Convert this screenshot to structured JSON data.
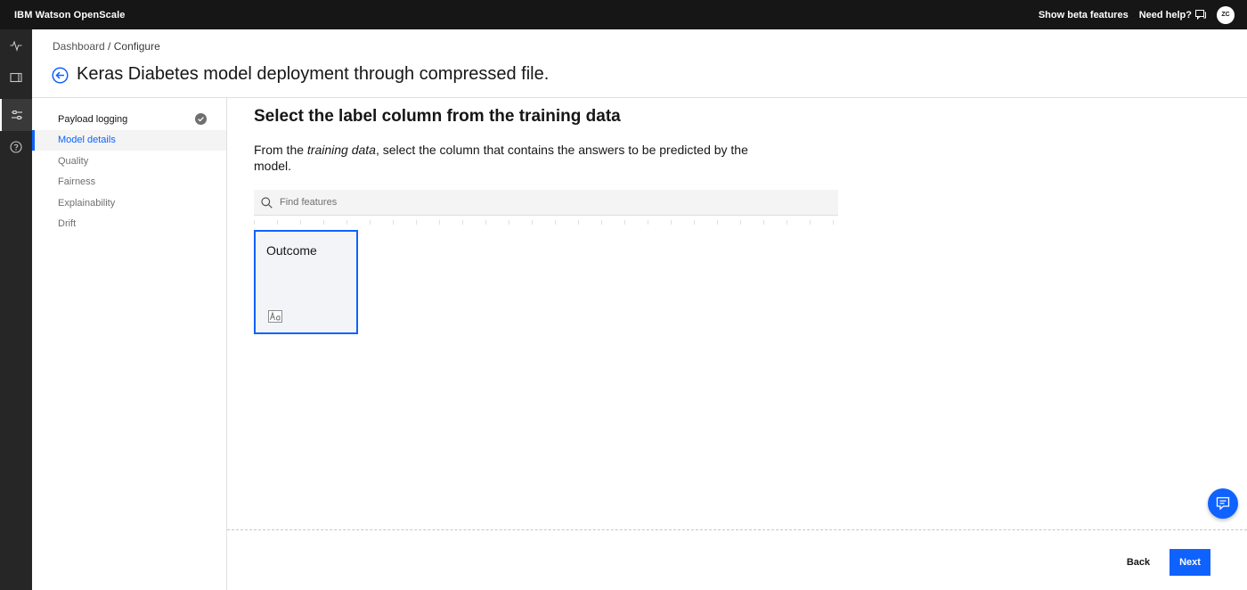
{
  "app": {
    "title": "IBM Watson OpenScale"
  },
  "topbar": {
    "beta_label": "Show beta features",
    "help_label": "Need help?",
    "avatar_initials": "ZC"
  },
  "rail": {
    "items": [
      {
        "icon": "activity-icon"
      },
      {
        "icon": "model-icon"
      },
      {
        "icon": "settings-adjust-icon",
        "active": true
      },
      {
        "icon": "help-icon"
      }
    ]
  },
  "breadcrumb": {
    "parent": "Dashboard",
    "separator": " / ",
    "current": "Configure"
  },
  "page": {
    "title": "Keras Diabetes model deployment through compressed file."
  },
  "steps": [
    {
      "label": "Payload logging",
      "status": "done"
    },
    {
      "label": "Model details",
      "status": "current"
    },
    {
      "label": "Quality",
      "status": "pending"
    },
    {
      "label": "Fairness",
      "status": "pending"
    },
    {
      "label": "Explainability",
      "status": "pending"
    },
    {
      "label": "Drift",
      "status": "pending"
    }
  ],
  "main": {
    "title": "Select the label column from the training data",
    "description_prefix": "From the ",
    "description_emphasis": "training data",
    "description_suffix": ", select the column that contains the answers to be predicted by the model.",
    "search_placeholder": "Find features",
    "tiles": [
      {
        "label": "Outcome",
        "type_icon": "string-type-icon",
        "selected": true
      }
    ]
  },
  "footer": {
    "back_label": "Back",
    "next_label": "Next"
  },
  "colors": {
    "accent": "#0f62fe",
    "header_bg": "#161616",
    "rail_bg": "#262626"
  }
}
